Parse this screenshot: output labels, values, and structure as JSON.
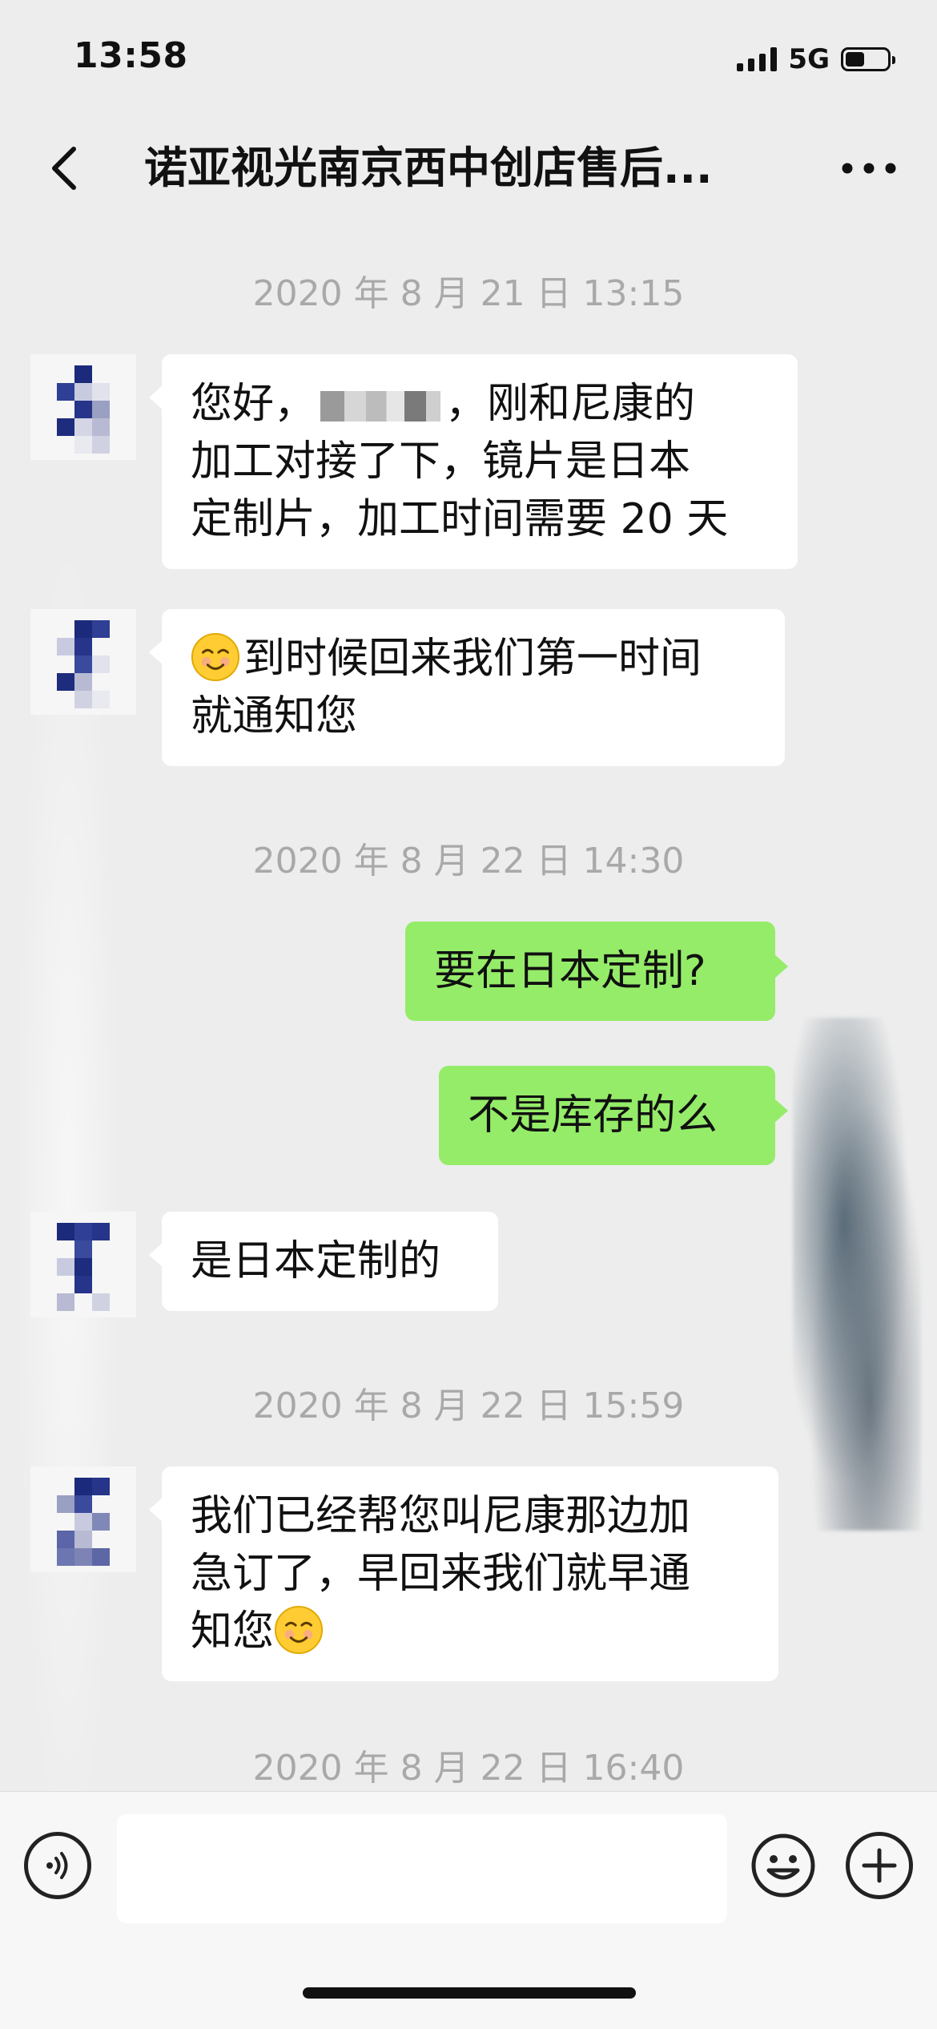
{
  "status_bar": {
    "time": "13:58",
    "network": "5G",
    "battery_level": 0.45
  },
  "nav": {
    "title": "诺亚视光南京西中创店售后...",
    "back_icon": "chevron-left-icon",
    "more_icon": "more-dots-icon"
  },
  "chat": {
    "timestamps": [
      "2020 年 8 月 21 日 13:15",
      "2020 年 8 月 22 日 14:30",
      "2020 年 8 月 22 日 15:59",
      "2020 年 8 月 22 日 16:40"
    ],
    "messages": [
      {
        "sender": "other",
        "line1_before": "您好，",
        "line1_after": "，刚和尼康的",
        "line2": "加工对接了下，镜片是日本",
        "line3": "定制片，加工时间需要 20 天"
      },
      {
        "sender": "other",
        "line1": "到时候回来我们第一时间",
        "line2": "就通知您",
        "emoji": "smiley-emoji"
      },
      {
        "sender": "self",
        "text": "要在日本定制?"
      },
      {
        "sender": "self",
        "text": "不是库存的么"
      },
      {
        "sender": "other",
        "text": "是日本定制的"
      },
      {
        "sender": "other",
        "line1": "我们已经帮您叫尼康那边加",
        "line2": "急订了，早回来我们就早通",
        "line3": "知您",
        "emoji": "smiley-emoji"
      }
    ]
  },
  "input_bar": {
    "voice_icon": "voice-icon",
    "emoji_icon": "emoji-icon",
    "plus_icon": "plus-icon",
    "input_value": ""
  },
  "colors": {
    "background": "#ededed",
    "self_bubble": "#95ec69",
    "other_bubble": "#ffffff",
    "timestamp": "#a9a9a9"
  }
}
